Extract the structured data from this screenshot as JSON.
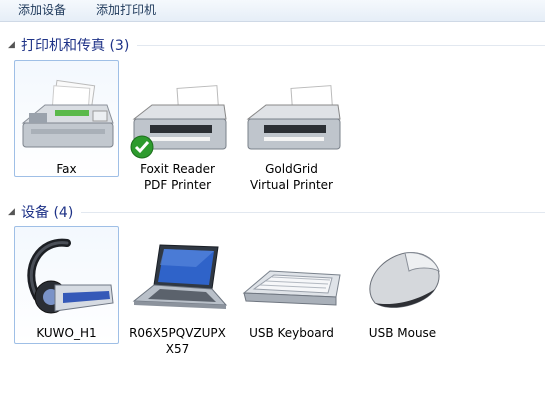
{
  "toolbar": {
    "add_device": "添加设备",
    "add_printer": "添加打印机"
  },
  "groups": {
    "printers": {
      "title": "打印机和传真 (3)"
    },
    "devices": {
      "title": "设备 (4)"
    }
  },
  "printers": [
    {
      "label": "Fax",
      "icon": "fax-icon"
    },
    {
      "label_line1": "Foxit Reader",
      "label_line2": "PDF Printer",
      "icon": "printer-icon",
      "badge": "default-check-icon"
    },
    {
      "label_line1": "GoldGrid",
      "label_line2": "Virtual Printer",
      "icon": "printer-icon"
    }
  ],
  "devices": [
    {
      "label": "KUWO_H1",
      "icon": "bluetooth-headset-icon"
    },
    {
      "label_line1": "R06X5PQVZUPX",
      "label_line2": "X57",
      "icon": "laptop-icon"
    },
    {
      "label": "USB Keyboard",
      "icon": "keyboard-icon"
    },
    {
      "label": "USB Mouse",
      "icon": "mouse-icon"
    }
  ],
  "colors": {
    "group_title": "#1e3287",
    "selection_border": "#9fbfe6",
    "check_green": "#2e9b2e"
  }
}
